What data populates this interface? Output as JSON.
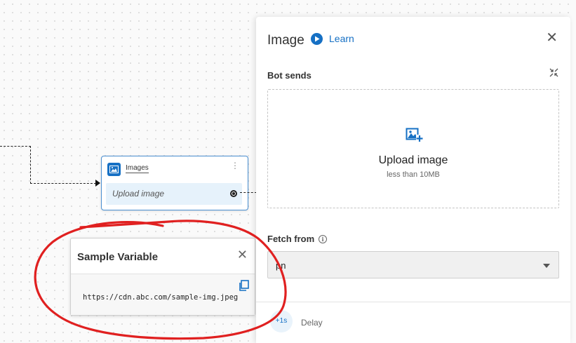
{
  "node": {
    "title": "Images",
    "menu_glyph": "⋮",
    "body_text": "Upload image"
  },
  "sample_variable": {
    "title": "Sample Variable",
    "close_glyph": "✕",
    "url": "https://cdn.abc.com/sample-img.jpeg"
  },
  "panel": {
    "title": "Image",
    "learn_label": "Learn",
    "close_glyph": "✕",
    "bot_sends_label": "Bot sends",
    "upload_title": "Upload image",
    "upload_subtitle": "less than 10MB",
    "fetch_label": "Fetch from",
    "info_glyph": "i",
    "fetch_value": "pn",
    "delay_button": "+1s",
    "delay_label": "Delay"
  },
  "colors": {
    "accent": "#1670c4",
    "annotation": "#e02020",
    "node_body": "#e6f2fb"
  },
  "icons": [
    "image-icon",
    "kebab-menu-icon",
    "output-port-icon",
    "close-icon",
    "copy-icon",
    "play-icon",
    "minimize-icon",
    "add-image-icon",
    "info-icon",
    "chevron-down-icon"
  ]
}
